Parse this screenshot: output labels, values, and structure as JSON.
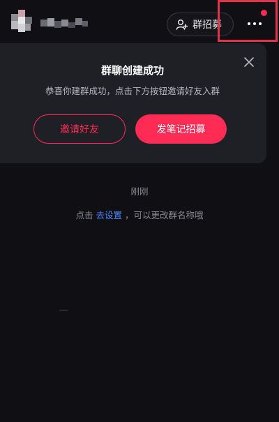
{
  "header": {
    "recruit_button_label": "群招募"
  },
  "success_card": {
    "title": "群聊创建成功",
    "subtitle": "恭喜你建群成功，点击下方按钮邀请好友入群",
    "invite_button_label": "邀请好友",
    "note_button_label": "发笔记招募"
  },
  "messages": {
    "timestamp": "刚刚",
    "hint_prefix": "点击",
    "hint_link": "去设置",
    "hint_suffix": "，可以更改群名称哦"
  },
  "icons": {
    "recruit": "person-add-icon",
    "more": "more-dots-icon",
    "close": "close-icon"
  },
  "colors": {
    "background": "#101014",
    "card": "#1f1f26",
    "accent": "#fe2c55",
    "link": "#4a86ff",
    "highlight_box": "#e0344a"
  }
}
